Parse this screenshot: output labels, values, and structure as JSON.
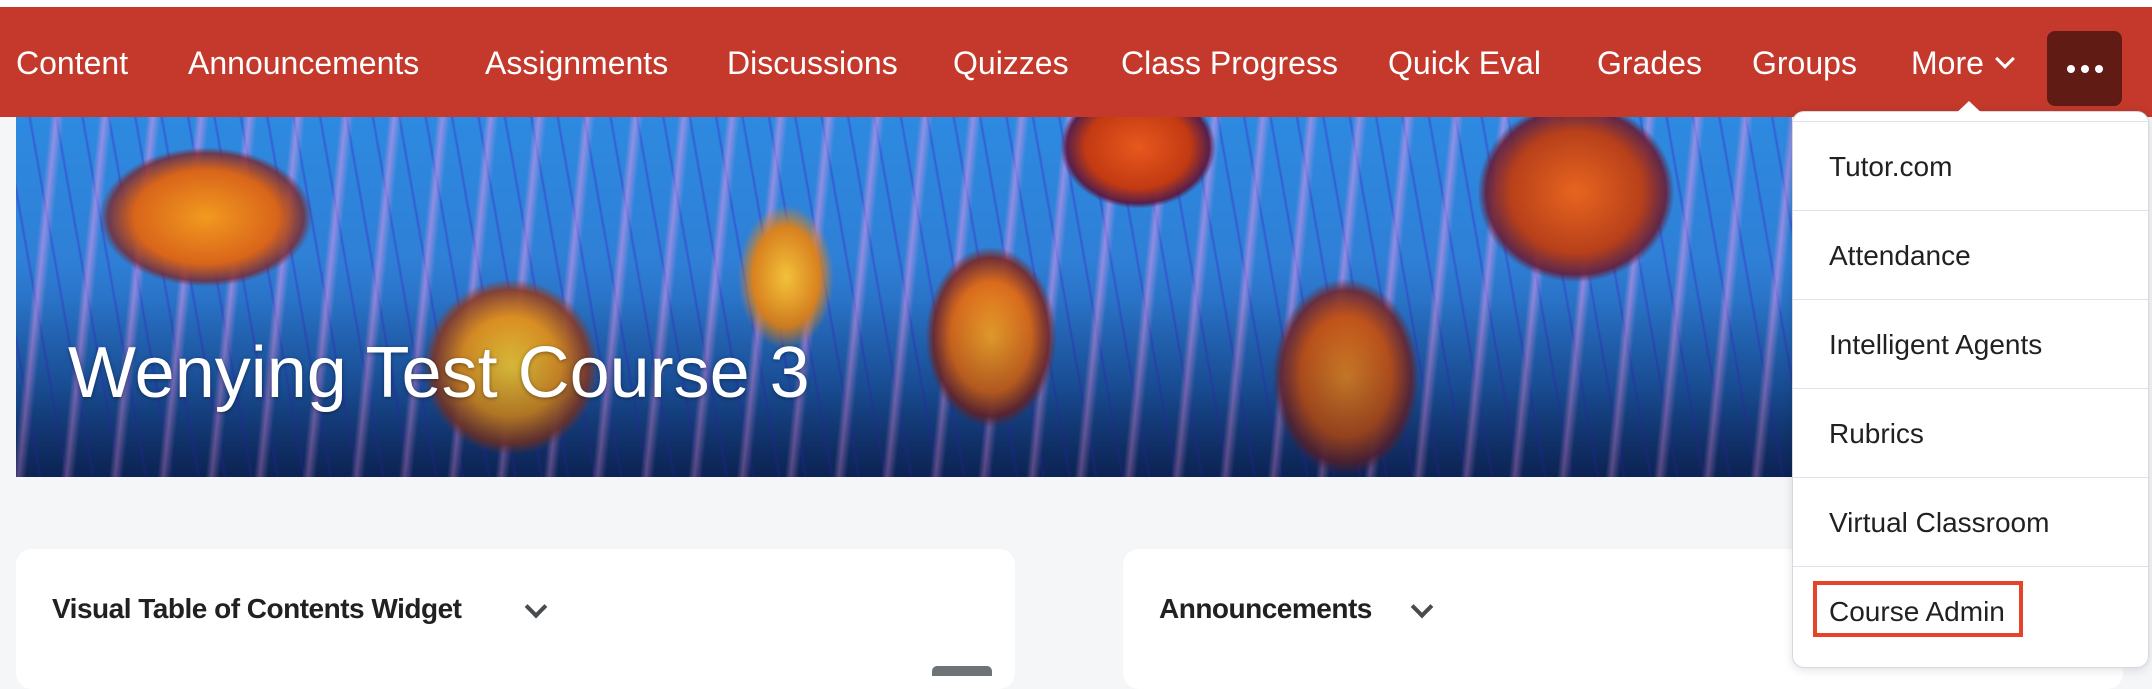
{
  "nav": {
    "items": [
      {
        "label": "Content"
      },
      {
        "label": "Announcements"
      },
      {
        "label": "Assignments"
      },
      {
        "label": "Discussions"
      },
      {
        "label": "Quizzes"
      },
      {
        "label": "Class Progress"
      },
      {
        "label": "Quick Eval"
      },
      {
        "label": "Grades"
      },
      {
        "label": "Groups"
      }
    ],
    "more_label": "More",
    "overflow_icon": "ellipsis-icon",
    "colors": {
      "bar": "#c4392b",
      "overflow_button": "#601b14"
    }
  },
  "banner": {
    "course_title": "Wenying Test Course 3",
    "image": "jellyfish-banner"
  },
  "widgets": [
    {
      "title": "Visual Table of Contents Widget"
    },
    {
      "title": "Announcements"
    }
  ],
  "more_menu": {
    "items": [
      {
        "label": "Tutor.com"
      },
      {
        "label": "Attendance"
      },
      {
        "label": "Intelligent Agents"
      },
      {
        "label": "Rubrics"
      },
      {
        "label": "Virtual Classroom"
      },
      {
        "label": "Course Admin",
        "highlighted": true
      }
    ],
    "highlight_color": "#e5432a"
  }
}
